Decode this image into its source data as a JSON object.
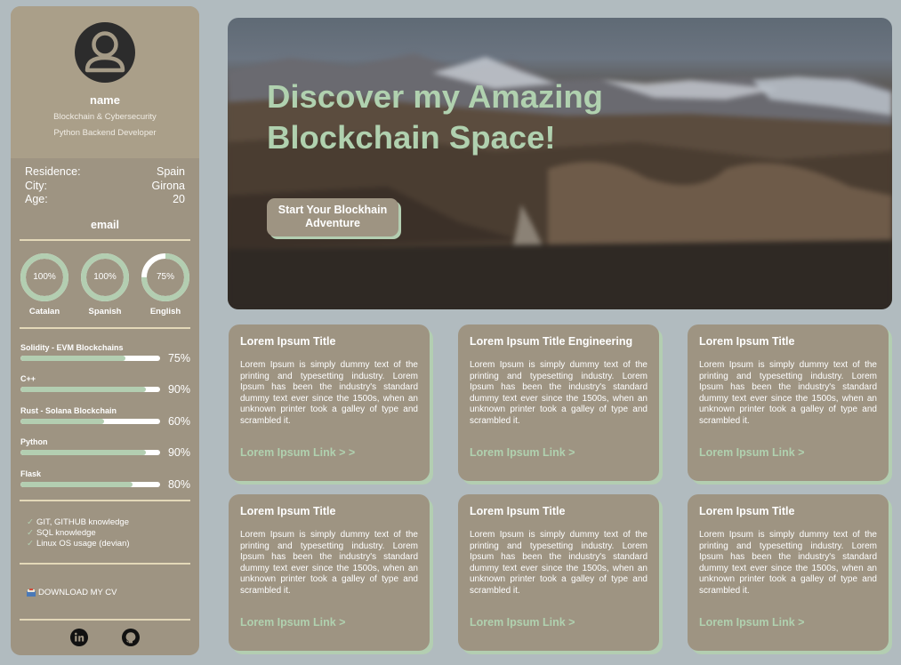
{
  "profile": {
    "name": "name",
    "role1": "Blockchain & Cybersecurity",
    "role2": "Python Backend Developer",
    "residence_label": "Residence:",
    "residence": "Spain",
    "city_label": "City:",
    "city": "Girona",
    "age_label": "Age:",
    "age": "20",
    "email": "email"
  },
  "languages": [
    {
      "name": "Catalan",
      "label": "100%",
      "level": 1.0
    },
    {
      "name": "Spanish",
      "label": "100%",
      "level": 1.0
    },
    {
      "name": "English",
      "label": "75%",
      "level": 0.75
    }
  ],
  "skills": [
    {
      "name": "Solidity - EVM Blockchains",
      "label": "75%",
      "level": 0.75
    },
    {
      "name": "C++",
      "label": "90%",
      "level": 0.9
    },
    {
      "name": "Rust - Solana Blockchain",
      "label": "60%",
      "level": 0.6
    },
    {
      "name": "Python",
      "label": "90%",
      "level": 0.9
    },
    {
      "name": "Flask",
      "label": "80%",
      "level": 0.8
    }
  ],
  "knowledge": [
    "GIT, GITHUB knowledge",
    "SQL knowledge",
    "Linux OS usage (devian)"
  ],
  "download_label": "DOWNLOAD MY CV",
  "social": [
    "linkedin-icon",
    "github-icon"
  ],
  "hero": {
    "title": "Discover my Amazing Blockchain Space!",
    "button": "Start Your Blockhain Adventure"
  },
  "cards": [
    {
      "title": "Lorem Ipsum Title",
      "text": "Lorem Ipsum is simply dummy text of the printing and typesetting industry. Lorem Ipsum has been the industry's standard dummy text ever since the 1500s, when an unknown printer took a galley of type and scrambled it.",
      "link": "Lorem Ipsum Link  >  >"
    },
    {
      "title": "Lorem Ipsum Title Engineering",
      "text": "Lorem Ipsum is simply dummy text of the printing and typesetting industry. Lorem Ipsum has been the industry's standard dummy text ever since the 1500s, when an unknown printer took a galley of type and scrambled it.",
      "link": "Lorem Ipsum Link  >"
    },
    {
      "title": "Lorem Ipsum Title",
      "text": "Lorem Ipsum is simply dummy text of the printing and typesetting industry. Lorem Ipsum has been the industry's standard dummy text ever since the 1500s, when an unknown printer took a galley of type and scrambled it.",
      "link": "Lorem Ipsum Link  >"
    },
    {
      "title": "Lorem Ipsum Title",
      "text": "Lorem Ipsum is simply dummy text of the printing and typesetting industry. Lorem Ipsum has been the industry's standard dummy text ever since the 1500s, when an unknown printer took a galley of type and scrambled it.",
      "link": "Lorem Ipsum Link  >"
    },
    {
      "title": "Lorem Ipsum Title",
      "text": "Lorem Ipsum is simply dummy text of the printing and typesetting industry. Lorem Ipsum has been the industry's standard dummy text ever since the 1500s, when an unknown printer took a galley of type and scrambled it.",
      "link": "Lorem Ipsum Link  >"
    },
    {
      "title": "Lorem Ipsum Title",
      "text": "Lorem Ipsum is simply dummy text of the printing and typesetting industry. Lorem Ipsum has been the industry's standard dummy text ever since the 1500s, when an unknown printer took a galley of type and scrambled it.",
      "link": "Lorem Ipsum Link  >"
    }
  ],
  "colors": {
    "accent": "#b3ceb1",
    "panel": "#9e9482",
    "background": "#b1bbbf"
  }
}
